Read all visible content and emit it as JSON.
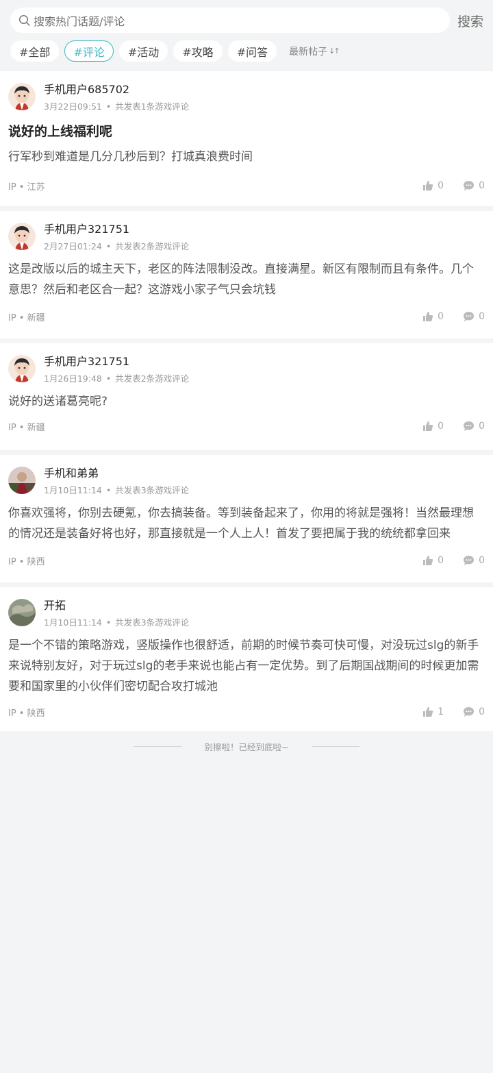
{
  "search": {
    "placeholder": "搜索热门话题/评论",
    "button": "搜索"
  },
  "tags": [
    "#全部",
    "#评论",
    "#活动",
    "#攻略",
    "#问答"
  ],
  "active_tag": "#评论",
  "sort": {
    "label": "最新帖子",
    "icon": "sort-arrows-icon"
  },
  "posts": [
    {
      "username": "手机用户685702",
      "date": "3月22日09:51",
      "stat": "共发表1条游戏评论",
      "title": "说好的上线福利呢",
      "content": "行军秒到难道是几分几秒后到？打城真浪费时间",
      "ip": "IP • 江苏",
      "likes": "0",
      "comments": "0"
    },
    {
      "username": "手机用户321751",
      "date": "2月27日01:24",
      "stat": "共发表2条游戏评论",
      "content": "这是改版以后的城主天下，老区的阵法限制没改。直接满星。新区有限制而且有条件。几个意思？然后和老区合一起？这游戏小家子气只会坑钱",
      "ip": "IP • 新疆",
      "likes": "0",
      "comments": "0"
    },
    {
      "username": "手机用户321751",
      "date": "1月26日19:48",
      "stat": "共发表2条游戏评论",
      "content": "说好的送诸葛亮呢?",
      "ip": "IP • 新疆",
      "likes": "0",
      "comments": "0"
    },
    {
      "username": "手机和弟弟",
      "date": "1月10日11:14",
      "stat": "共发表3条游戏评论",
      "content": "你喜欢强将，你别去硬氪，你去搞装备。等到装备起来了，你用的将就是强将！当然最理想的情况还是装备好将也好，那直接就是一个人上人！首发了要把属于我的统统都拿回来",
      "ip": "IP • 陕西",
      "likes": "0",
      "comments": "0"
    },
    {
      "username": "开拓",
      "date": "1月10日11:14",
      "stat": "共发表3条游戏评论",
      "content": "是一个不错的策略游戏，竖版操作也很舒适，前期的时候节奏可快可慢，对没玩过slg的新手来说特别友好，对于玩过slg的老手来说也能占有一定优势。到了后期国战期间的时候更加需要和国家里的小伙伴们密切配合攻打城池",
      "ip": "IP • 陕西",
      "likes": "1",
      "comments": "0"
    }
  ],
  "end_text": "别擦啦！已经到底啦~"
}
